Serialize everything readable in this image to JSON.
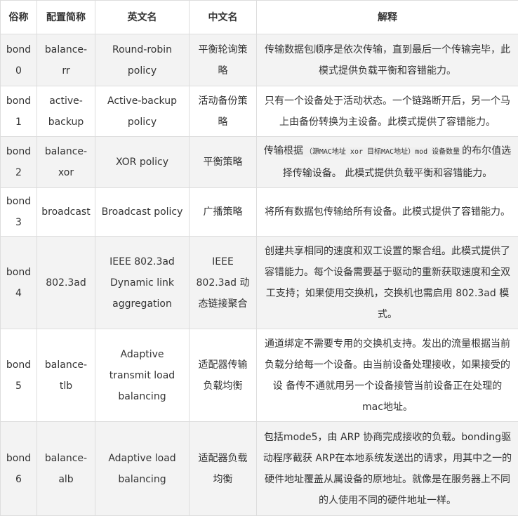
{
  "headers": {
    "alias": "俗称",
    "short": "配置简称",
    "en": "英文名",
    "zh": "中文名",
    "desc": "解释"
  },
  "rows": [
    {
      "alias": "bond0",
      "short": "balance-rr",
      "en": "Round-robin policy",
      "zh": "平衡轮询策略",
      "desc": "传输数据包顺序是依次传输，直到最后一个传输完毕，此模式提供负载平衡和容错能力。"
    },
    {
      "alias": "bond1",
      "short": "active-backup",
      "en": "Active-backup policy",
      "zh": "活动备份策略",
      "desc": "只有一个设备处于活动状态。一个链路断开后，另一个马上由备份转换为主设备。此模式提供了容错能力。"
    },
    {
      "alias": "bond2",
      "short": "balance-xor",
      "en": "XOR policy",
      "zh": "平衡策略",
      "desc_before": "传输根据",
      "desc_code": "（源MAC地址 xor 目标MAC地址）mod 设备数量",
      "desc_after": "的布尔值选择传输设备。 此模式提供负载平衡和容错能力。"
    },
    {
      "alias": "bond3",
      "short": "broadcast",
      "en": "Broadcast policy",
      "zh": "广播策略",
      "desc": "将所有数据包传输给所有设备。此模式提供了容错能力。"
    },
    {
      "alias": "bond4",
      "short": "802.3ad",
      "en": "IEEE 802.3ad Dynamic link aggregation",
      "zh": "IEEE 802.3ad 动态链接聚合",
      "desc": "创建共享相同的速度和双工设置的聚合组。此模式提供了容错能力。每个设备需要基于驱动的重新获取速度和全双工支持；如果使用交换机，交换机也需启用 802.3ad 模式。"
    },
    {
      "alias": "bond5",
      "short": "balance-tlb",
      "en": "Adaptive transmit load balancing",
      "zh": "适配器传输负载均衡",
      "desc": "通道绑定不需要专用的交换机支持。发出的流量根据当前负载分给每一个设备。由当前设备处理接收，如果接受的设 备传不通就用另一个设备接管当前设备正在处理的mac地址。"
    },
    {
      "alias": "bond6",
      "short": "balance-alb",
      "en": "Adaptive load balancing",
      "zh": "适配器负载均衡",
      "desc": "包括mode5，由 ARP 协商完成接收的负载。bonding驱动程序截获 ARP在本地系统发送出的请求，用其中之一的硬件地址覆盖从属设备的原地址。就像是在服务器上不同的人使用不同的硬件地址一样。"
    }
  ]
}
